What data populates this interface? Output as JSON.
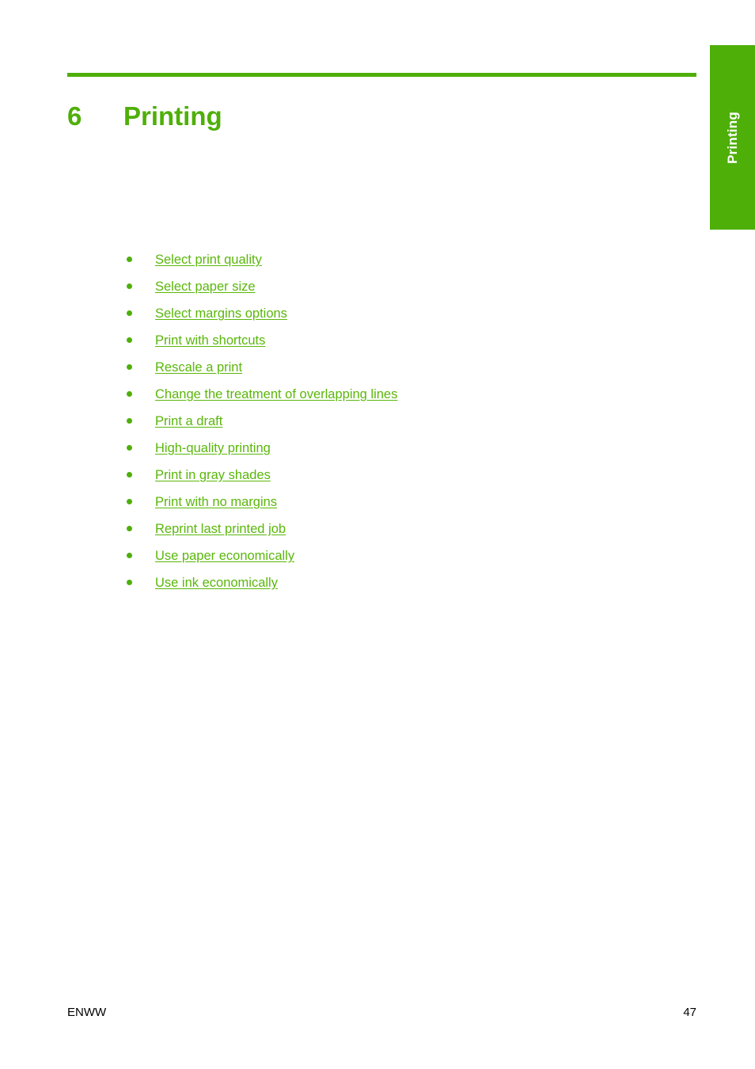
{
  "side_tab": {
    "label": "Printing"
  },
  "chapter": {
    "number": "6",
    "title": "Printing"
  },
  "links": [
    {
      "label": "Select print quality"
    },
    {
      "label": "Select paper size"
    },
    {
      "label": "Select margins options"
    },
    {
      "label": "Print with shortcuts"
    },
    {
      "label": "Rescale a print"
    },
    {
      "label": "Change the treatment of overlapping lines"
    },
    {
      "label": "Print a draft"
    },
    {
      "label": "High-quality printing"
    },
    {
      "label": "Print in gray shades"
    },
    {
      "label": "Print with no margins"
    },
    {
      "label": "Reprint last printed job"
    },
    {
      "label": "Use paper economically"
    },
    {
      "label": "Use ink economically"
    }
  ],
  "footer": {
    "left": "ENWW",
    "page_number": "47"
  },
  "colors": {
    "accent_green": "#4FAF09",
    "link_green": "#5AB70B",
    "text_black": "#000000",
    "tab_text": "#FFFFFF"
  }
}
